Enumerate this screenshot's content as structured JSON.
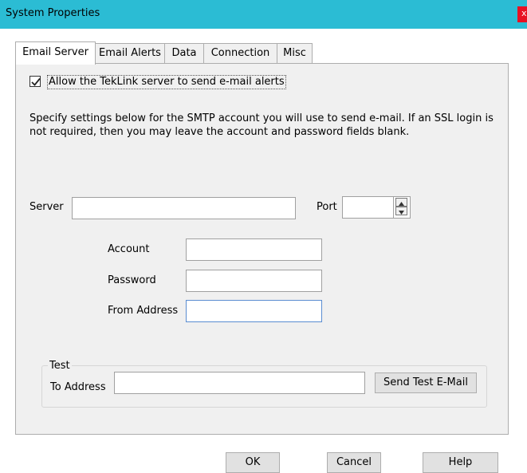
{
  "window": {
    "title": "System Properties",
    "close_glyph": "x"
  },
  "tabs": [
    {
      "label": "Email Server",
      "active": true
    },
    {
      "label": "Email Alerts",
      "active": false
    },
    {
      "label": "Data",
      "active": false
    },
    {
      "label": "Connection",
      "active": false
    },
    {
      "label": "Misc",
      "active": false
    }
  ],
  "email_server": {
    "allow_checkbox": {
      "label": "Allow the TekLink server to send e-mail alerts",
      "checked": true
    },
    "description": "Specify settings below for the SMTP account you will use to send e-mail. If an SSL login is not required, then you may leave the account and password fields blank.",
    "server_label": "Server",
    "server_value": "",
    "port_label": "Port",
    "port_value": "",
    "account_label": "Account",
    "account_value": "",
    "password_label": "Password",
    "password_value": "",
    "from_address_label": "From Address",
    "from_address_value": "",
    "test": {
      "group_label": "Test",
      "to_address_label": "To Address",
      "to_address_value": "",
      "send_button_label": "Send Test E-Mail"
    }
  },
  "footer": {
    "ok_label": "OK",
    "cancel_label": "Cancel",
    "help_label": "Help"
  },
  "colors": {
    "titlebar": "#2bbcd4",
    "close": "#e81123",
    "panel": "#f0f0f0",
    "focus_border": "#5a8dd1"
  }
}
